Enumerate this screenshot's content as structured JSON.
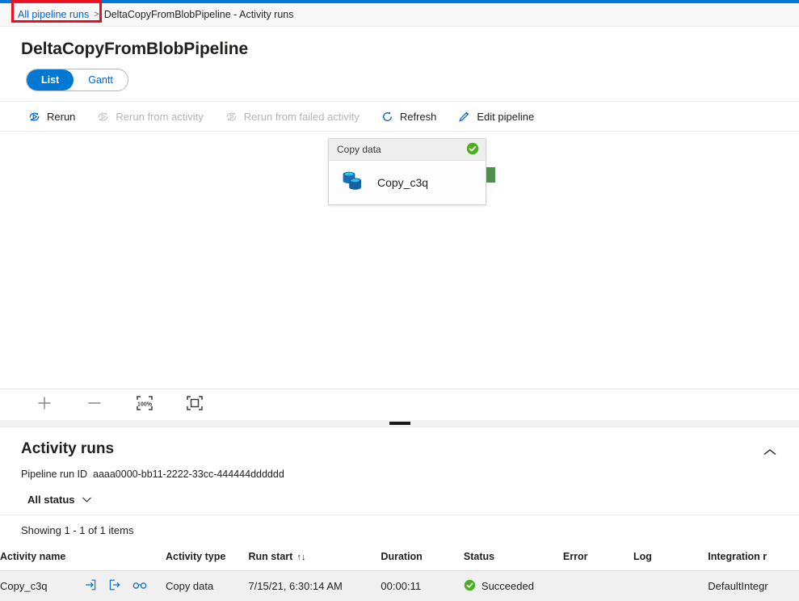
{
  "breadcrumb": {
    "link_label": "All pipeline runs",
    "separator": ">",
    "current": "DeltaCopyFromBlobPipeline - Activity runs"
  },
  "page": {
    "title": "DeltaCopyFromBlobPipeline"
  },
  "pivot": {
    "items": [
      {
        "label": "List",
        "active": true
      },
      {
        "label": "Gantt",
        "active": false
      }
    ]
  },
  "toolbar": {
    "rerun_label": "Rerun",
    "rerun_from_activity_label": "Rerun from activity",
    "rerun_from_failed_label": "Rerun from failed activity",
    "refresh_label": "Refresh",
    "edit_pipeline_label": "Edit pipeline"
  },
  "canvas": {
    "node": {
      "type_label": "Copy data",
      "name": "Copy_c3q",
      "status": "succeeded"
    },
    "zoom_controls": {
      "zoom_in": "zoom-in",
      "zoom_out": "zoom-out",
      "zoom_100": "100%",
      "fit_to_screen": "fit-to-screen"
    }
  },
  "activity_runs": {
    "title": "Activity runs",
    "run_id_label": "Pipeline run ID",
    "run_id_value": "aaaa0000-bb11-2222-33cc-444444dddddd",
    "status_filter": "All status",
    "showing": "Showing 1 - 1 of 1 items",
    "columns": [
      "Activity name",
      "Activity type",
      "Run start",
      "Duration",
      "Status",
      "Error",
      "Log",
      "Integration r"
    ],
    "sort_indicator": "↑↓",
    "rows": [
      {
        "activity_name": "Copy_c3q",
        "activity_type": "Copy data",
        "run_start": "7/15/21, 6:30:14 AM",
        "duration": "00:00:11",
        "status": "Succeeded",
        "error": "",
        "log": "",
        "integration_runtime": "DefaultIntegr"
      }
    ]
  },
  "colors": {
    "accent": "#0078d4",
    "link": "#0066cc",
    "success": "#4caf22",
    "highlight": "#e81123",
    "port": "#4e8f4e"
  }
}
